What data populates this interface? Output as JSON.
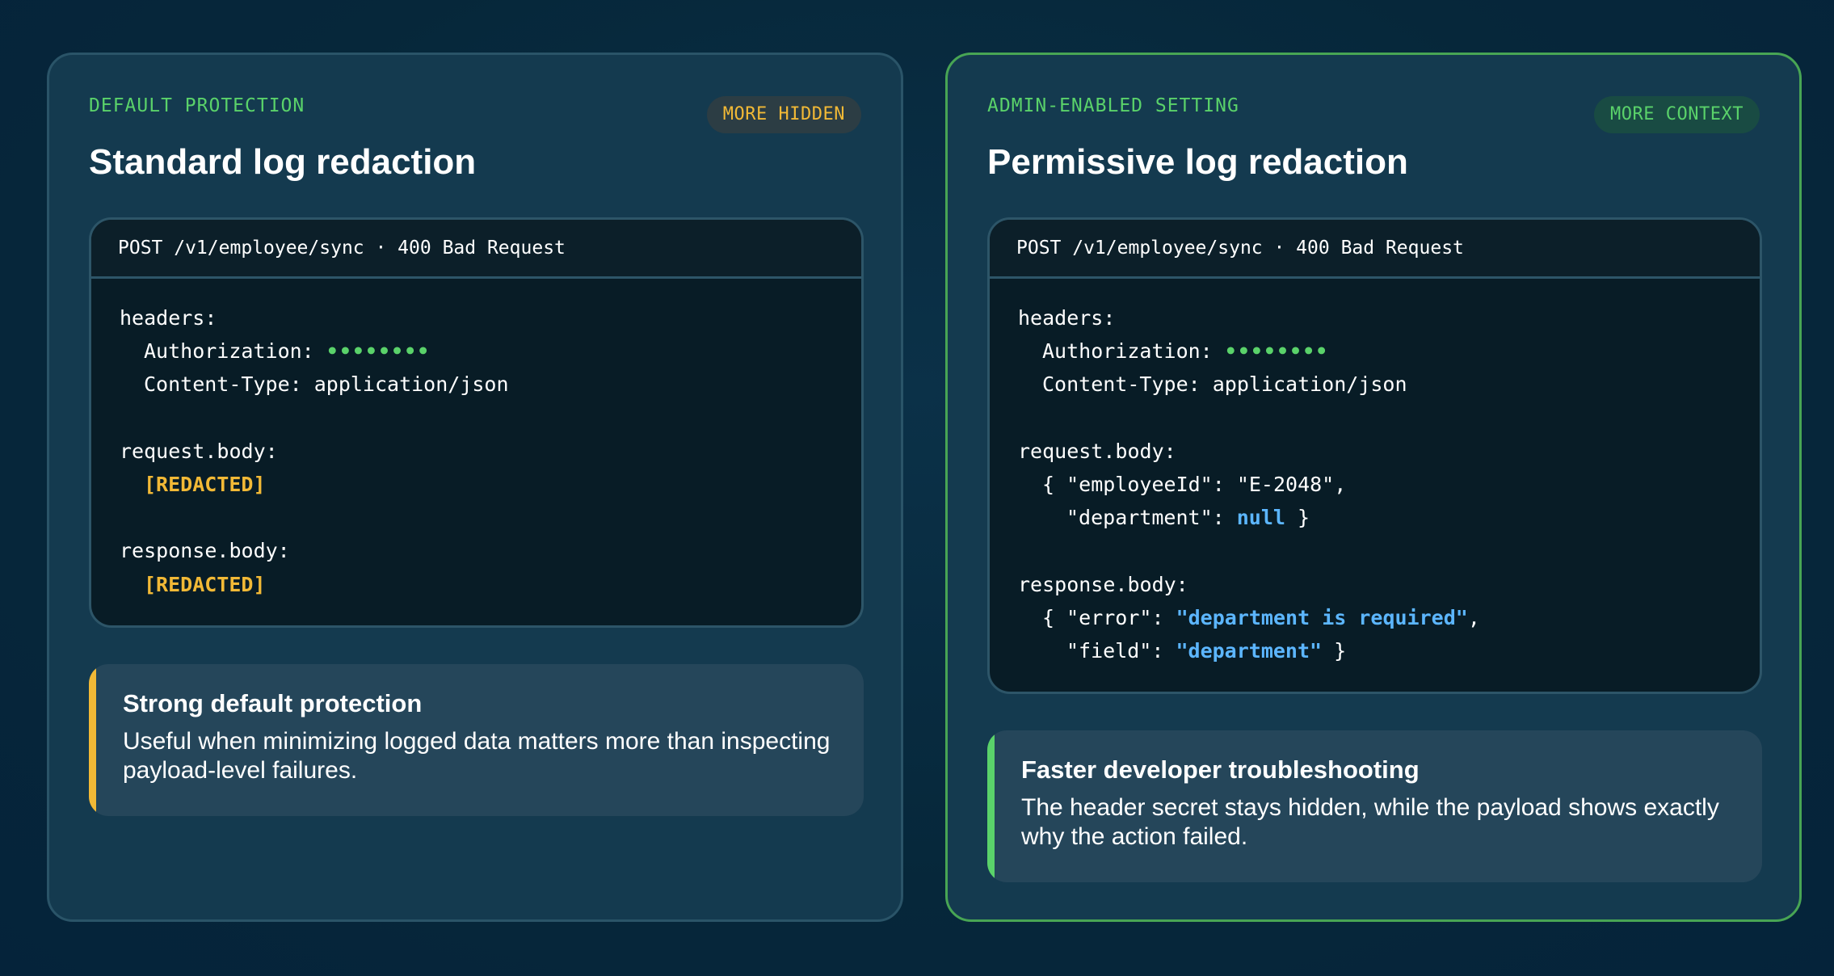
{
  "left_panel": {
    "eyebrow": "DEFAULT PROTECTION",
    "badge": "MORE HIDDEN",
    "title": "Standard log redaction",
    "request_line": "POST /v1/employee/sync · 400 Bad Request",
    "code": {
      "headers_label": "headers:",
      "auth_key": "Authorization: ",
      "auth_value": "••••••••",
      "content_type": "Content-Type: application/json",
      "request_label": "request.body:",
      "request_value": "[REDACTED]",
      "response_label": "response.body:",
      "response_value": "[REDACTED]"
    },
    "note": {
      "title": "Strong default protection",
      "text": "Useful when minimizing logged data matters more than inspecting payload-level failures."
    }
  },
  "right_panel": {
    "eyebrow": "ADMIN-ENABLED SETTING",
    "badge": "MORE CONTEXT",
    "title": "Permissive log redaction",
    "request_line": "POST /v1/employee/sync · 400 Bad Request",
    "code": {
      "headers_label": "headers:",
      "auth_key": "Authorization: ",
      "auth_value": "••••••••",
      "content_type": "Content-Type: application/json",
      "request_label": "request.body:",
      "request_line1": "{ \"employeeId\": \"E-2048\",",
      "request_line2_key": "\"department\": ",
      "request_line2_value": "null",
      "request_line2_end": " }",
      "response_label": "response.body:",
      "response_line1_key": "{ \"error\": ",
      "response_line1_value": "\"department is required\"",
      "response_line1_end": ",",
      "response_line2_key": "\"field\": ",
      "response_line2_value": "\"department\"",
      "response_line2_end": " }"
    },
    "note": {
      "title": "Faster developer troubleshooting",
      "text": "The header secret stays hidden, while the payload shows exactly why the action failed."
    }
  },
  "colors": {
    "background": "#06273a",
    "panel": "#143a4f",
    "accent_green": "#5ad26a",
    "accent_amber": "#f2b936",
    "keyword_blue": "#5cb6ff",
    "code_bg": "#081c26"
  }
}
